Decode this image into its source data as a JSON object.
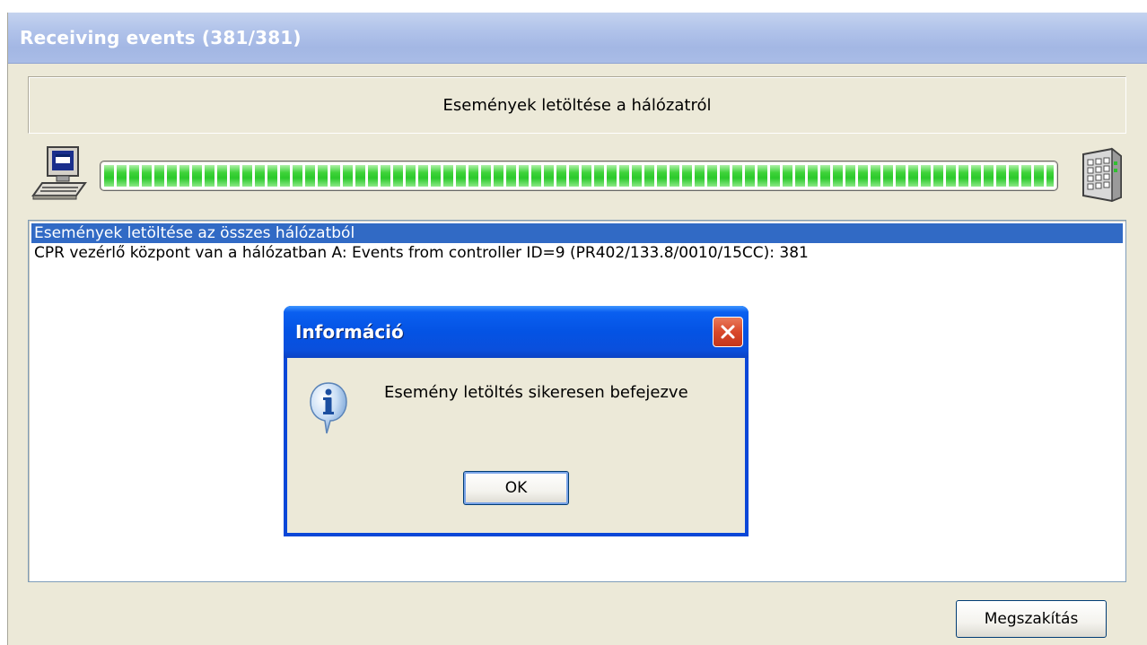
{
  "window": {
    "title": "Receiving events  (381/381)"
  },
  "header": {
    "text": "Események letöltése a hálózatról"
  },
  "progress": {
    "fraction": 1.0,
    "fill_color": "#2bc92b",
    "left_icon": "computer-icon",
    "right_icon": "controller-device-icon"
  },
  "log": {
    "rows": [
      {
        "text": "Események letöltése az összes hálózatból",
        "selected": true
      },
      {
        "text": "CPR vezérlő központ van a hálózatban A: Events from controller ID=9 (PR402/133.8/0010/15CC): 381",
        "selected": false
      }
    ],
    "selection_color": "#316ac5"
  },
  "buttons": {
    "abort_label": "Megszakítás"
  },
  "dialog": {
    "title": "Információ",
    "icon": "information-icon",
    "message": "Esemény letöltés sikeresen befejezve",
    "ok_label": "OK",
    "close_icon": "close-icon"
  }
}
